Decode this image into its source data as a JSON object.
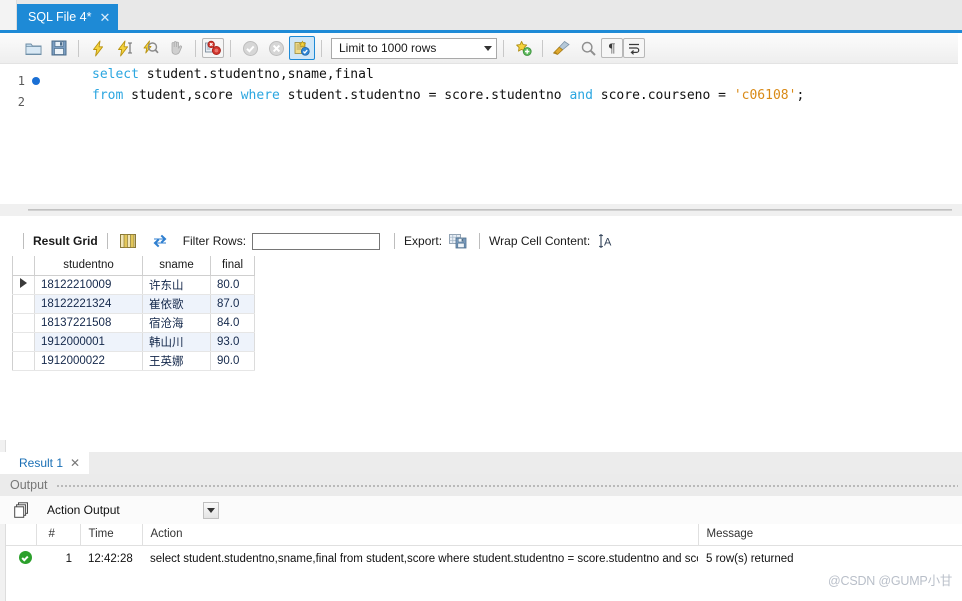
{
  "tab": {
    "title": "SQL File 4*",
    "close_icon": "close-icon"
  },
  "toolbar": {
    "buttons": [
      {
        "name": "open-sql-script-icon",
        "tip": "Open a SQL script file"
      },
      {
        "name": "save-script-icon",
        "tip": "Save the script"
      },
      {
        "name": "execute-statement-icon",
        "tip": "Execute"
      },
      {
        "name": "execute-current-statement-icon",
        "tip": "Execute current statement"
      },
      {
        "name": "explain-query-icon",
        "tip": "Explain query"
      },
      {
        "name": "stop-execution-icon",
        "tip": "Stop"
      },
      {
        "name": "toggle-stop-on-error-icon",
        "tip": "Toggle stop on error"
      },
      {
        "name": "commit-icon",
        "tip": "Commit"
      },
      {
        "name": "rollback-icon",
        "tip": "Rollback"
      },
      {
        "name": "autocommit-icon",
        "tip": "Toggle autocommit mode"
      }
    ],
    "limit_value": "Limit to 1000 rows",
    "right_buttons": [
      {
        "name": "add-snippet-icon",
        "tip": "Save snippet"
      },
      {
        "name": "beautify-query-icon",
        "tip": "Beautify SQL"
      },
      {
        "name": "find-icon",
        "tip": "Find"
      },
      {
        "name": "toggle-invisible-chars-icon",
        "tip": "Show invisible characters"
      },
      {
        "name": "toggle-wrapping-icon",
        "tip": "Toggle wrapping"
      }
    ]
  },
  "editor": {
    "lines": [
      {
        "number": "1",
        "has_marker": true,
        "tokens": [
          {
            "t": "select",
            "c": "kw"
          },
          {
            "t": " student.studentno,sname,final",
            "c": ""
          }
        ]
      },
      {
        "number": "2",
        "has_marker": false,
        "tokens": [
          {
            "t": "from",
            "c": "kw"
          },
          {
            "t": " student,score ",
            "c": ""
          },
          {
            "t": "where",
            "c": "kw"
          },
          {
            "t": " student.studentno = score.studentno ",
            "c": ""
          },
          {
            "t": "and",
            "c": "kw"
          },
          {
            "t": " score.courseno = ",
            "c": ""
          },
          {
            "t": "'c06108'",
            "c": "str"
          },
          {
            "t": ";",
            "c": ""
          }
        ]
      }
    ]
  },
  "grid_toolbar": {
    "result_grid_label": "Result Grid",
    "grid_view_icon": "grid-view-icon",
    "refresh_icon": "refresh-icon",
    "filter_label": "Filter Rows:",
    "filter_value": "",
    "filter_placeholder": "",
    "export_label": "Export:",
    "export_icon": "export-recordset-icon",
    "wrap_label": "Wrap Cell Content:",
    "wrap_icon": "wrap-cell-content-icon"
  },
  "result_grid": {
    "columns": [
      "studentno",
      "sname",
      "final"
    ],
    "selected_row_index": 0,
    "rows": [
      {
        "studentno": "18122210009",
        "sname": "许东山",
        "final": "80.0"
      },
      {
        "studentno": "18122221324",
        "sname": "崔依歌",
        "final": "87.0"
      },
      {
        "studentno": "18137221508",
        "sname": "宿沧海",
        "final": "84.0"
      },
      {
        "studentno": "1912000001",
        "sname": "韩山川",
        "final": "93.0"
      },
      {
        "studentno": "1912000022",
        "sname": "王英娜",
        "final": "90.0"
      }
    ]
  },
  "result_tabs": [
    {
      "label": "Result 1",
      "close_icon": "close-icon",
      "active": true
    }
  ],
  "output_panel": {
    "title": "Output",
    "selector_icon": "action-output-icon",
    "selector_value": "Action Output",
    "columns": [
      "#",
      "Time",
      "Action",
      "Message"
    ],
    "rows": [
      {
        "status": "success",
        "num": "1",
        "time": "12:42:28",
        "action": "select student.studentno,sname,final from student,score where student.studentno = score.studentno and scor...",
        "message": "5 row(s) returned"
      }
    ]
  },
  "watermark": {
    "text": "@CSDN @GUMP小甘"
  },
  "colors": {
    "accent": "#1e8ad6",
    "tab_active_bg": "#1e8ad6",
    "keyword": "#2ba6e0",
    "string": "#d98a17",
    "alt_row": "#eef3fb",
    "success": "#2ca02c"
  }
}
